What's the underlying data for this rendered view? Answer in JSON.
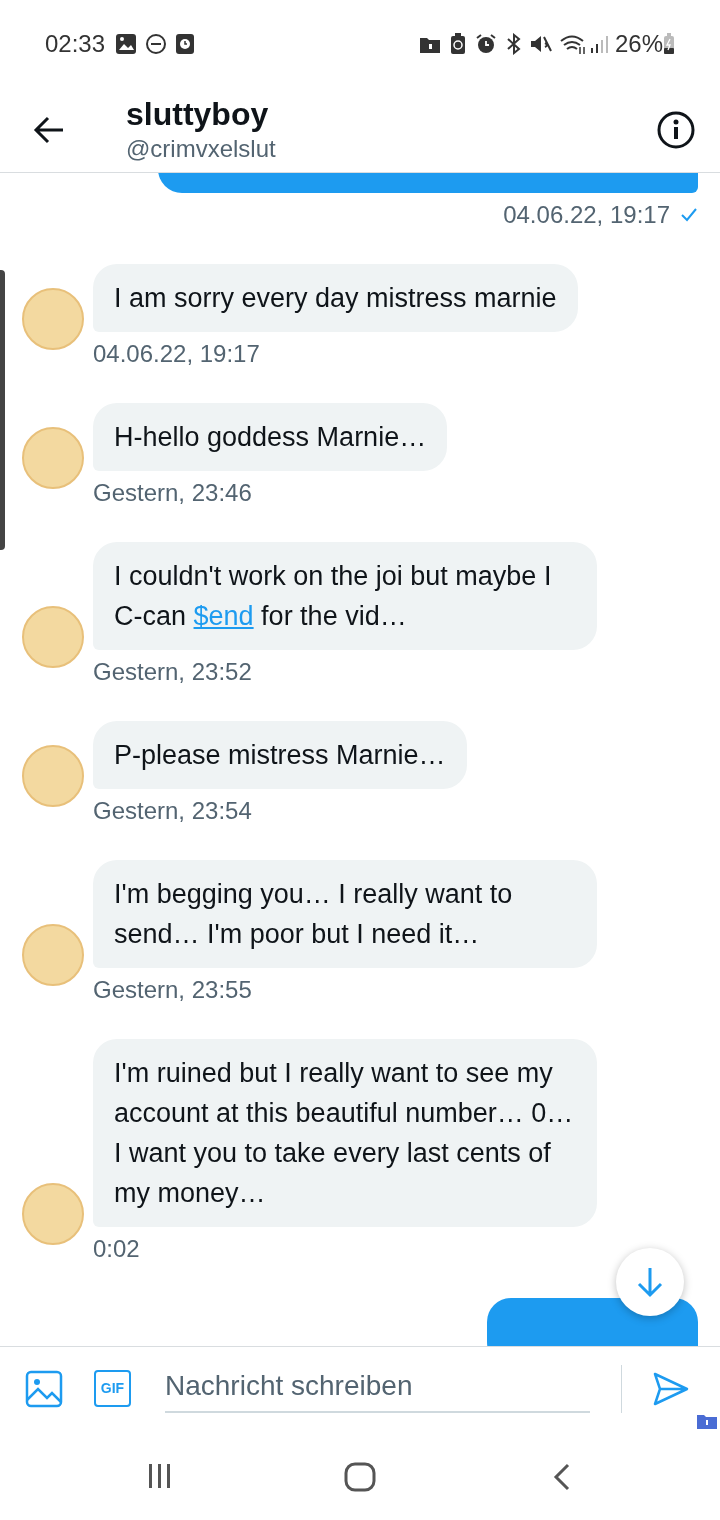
{
  "status_bar": {
    "time": "02:33",
    "battery": "26%"
  },
  "header": {
    "name": "sluttyboy",
    "handle": "@crimvxelslut"
  },
  "messages": [
    {
      "kind": "outgoing",
      "time": "04.06.22, 19:17",
      "sent": true
    },
    {
      "kind": "incoming",
      "segments": [
        {
          "kind": "plain",
          "text": "I am sorry every day mistress marnie"
        }
      ],
      "time": "04.06.22, 19:17"
    },
    {
      "kind": "incoming",
      "segments": [
        {
          "kind": "plain",
          "text": "H-hello goddess Marnie…"
        }
      ],
      "time": "Gestern, 23:46"
    },
    {
      "kind": "incoming",
      "segments": [
        {
          "kind": "plain",
          "text": "I couldn't work on the joi but maybe I C-can "
        },
        {
          "kind": "link",
          "text": "$end"
        },
        {
          "kind": "plain",
          "text": " for the vid…"
        }
      ],
      "time": "Gestern, 23:52"
    },
    {
      "kind": "incoming",
      "segments": [
        {
          "kind": "plain",
          "text": "P-please mistress Marnie…"
        }
      ],
      "time": "Gestern, 23:54"
    },
    {
      "kind": "incoming",
      "segments": [
        {
          "kind": "plain",
          "text": "I'm begging you… I really want to send… I'm poor but I need it…"
        }
      ],
      "time": "Gestern, 23:55"
    },
    {
      "kind": "incoming",
      "segments": [
        {
          "kind": "plain",
          "text": "I'm ruined but I really want to see my account at this beautiful number… 0… I want you to take every last cents of my money…"
        }
      ],
      "time": "0:02"
    },
    {
      "kind": "outgoing"
    }
  ],
  "composer": {
    "gif_label": "GIF",
    "placeholder": "Nachricht schreiben"
  }
}
